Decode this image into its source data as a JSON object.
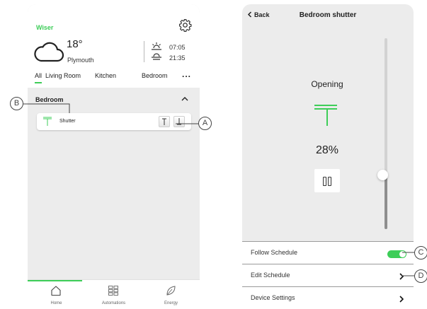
{
  "left_panel": {
    "brand": "Wiser",
    "weather": {
      "temperature": "18°",
      "location": "Plymouth",
      "sunrise": "07:05",
      "sunset": "21:35",
      "icon": "cloud-icon"
    },
    "tabs": [
      "All",
      "Living Room",
      "Kitchen",
      "Bedroom"
    ],
    "more_tabs": "...",
    "active_tab": "All",
    "room": {
      "name": "Bedroom",
      "device": {
        "name": "Shutter",
        "icon": "shutter-icon"
      }
    },
    "nav": {
      "items": [
        {
          "label": "Home",
          "icon": "home-icon"
        },
        {
          "label": "Automations",
          "icon": "automations-grid-icon"
        },
        {
          "label": "Energy",
          "icon": "leaf-icon"
        }
      ],
      "active": "Home"
    }
  },
  "right_panel": {
    "back": "Back",
    "title": "Bedroom shutter",
    "status": "Opening",
    "position_label": "28%",
    "position_value": 28,
    "settings": [
      {
        "label": "Follow Schedule",
        "control": "toggle",
        "enabled": true
      },
      {
        "label": "Edit Schedule",
        "control": "chevron"
      },
      {
        "label": "Device Settings",
        "control": "chevron"
      }
    ]
  },
  "callouts": [
    "A",
    "B",
    "C",
    "D"
  ],
  "colors": {
    "accent": "#3dcd58",
    "panel_background": "#ececec",
    "card_background": "#ffffff",
    "slider_fill": "#8e8e8e",
    "text": "#222222"
  }
}
